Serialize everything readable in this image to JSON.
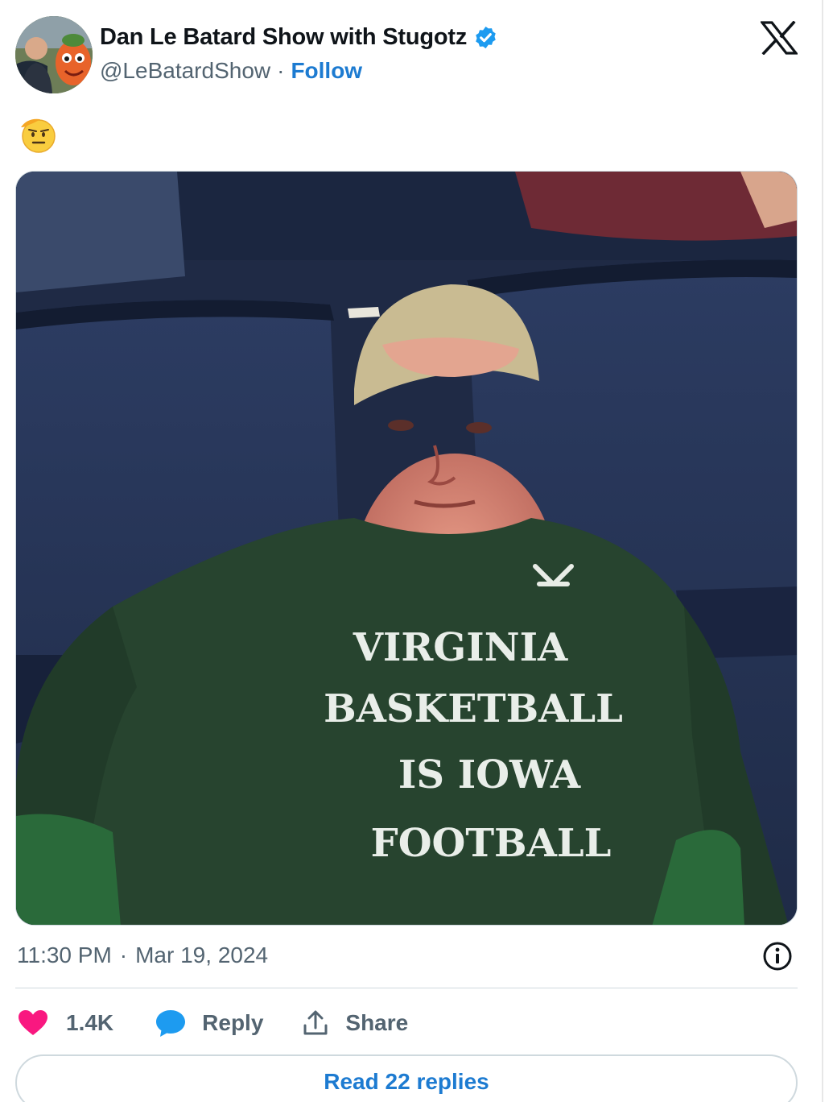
{
  "author": {
    "display_name": "Dan Le Batard Show with Stugotz",
    "handle": "@LeBatardShow",
    "separator": "·",
    "follow_label": "Follow",
    "verified": true
  },
  "tweet": {
    "emoji": "🫡",
    "media_shirt_text": [
      "VIRGINIA",
      "BASKETBALL",
      "IS IOWA",
      "FOOTBALL"
    ],
    "time": "11:30 PM",
    "separator": "·",
    "date": "Mar 19, 2024"
  },
  "actions": {
    "like_count": "1.4K",
    "reply_label": "Reply",
    "share_label": "Share"
  },
  "read_replies_label": "Read 22 replies",
  "icons": {
    "logo": "x-logo-icon",
    "verified": "verified-badge-icon",
    "info": "info-icon",
    "like": "heart-icon",
    "reply": "speech-bubble-icon",
    "share": "share-upload-icon"
  },
  "colors": {
    "accent": "#1d7bd1",
    "verified": "#1d9bf0",
    "like": "#f91880",
    "secondary_text": "#536471"
  }
}
